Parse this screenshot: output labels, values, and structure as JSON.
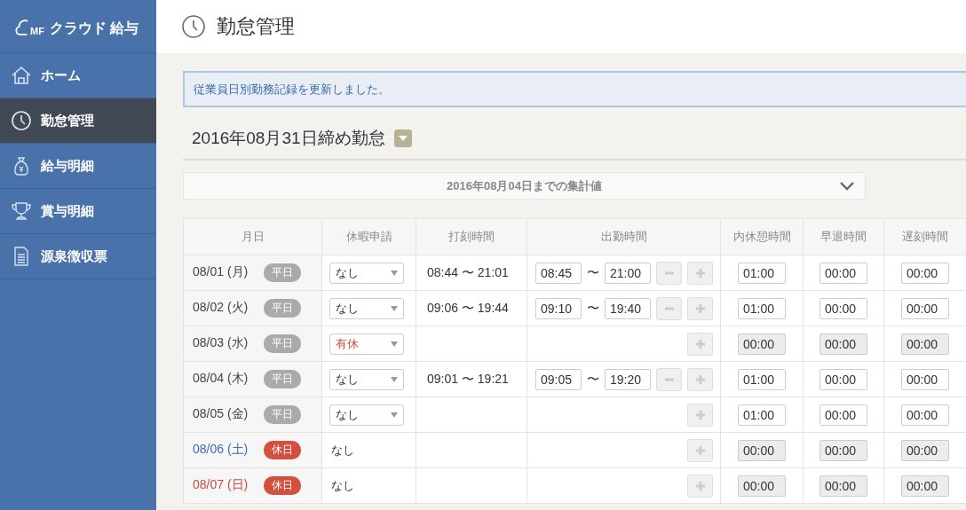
{
  "sidebar": {
    "logo": {
      "mark": "MF",
      "name": "クラウド 給与"
    },
    "items": [
      {
        "label": "ホーム",
        "selected": false
      },
      {
        "label": "勤怠管理",
        "selected": true
      },
      {
        "label": "給与明細",
        "selected": false
      },
      {
        "label": "賞与明細",
        "selected": false
      },
      {
        "label": "源泉徴収票",
        "selected": false
      }
    ]
  },
  "header": {
    "title": "勤怠管理"
  },
  "notice": "従業員日別勤務記録を更新しました。",
  "period": {
    "title": "2016年08月31日締め勤怠"
  },
  "summary": {
    "label": "2016年08月04日までの集計値",
    "expanded": false
  },
  "table": {
    "columns": [
      "月日",
      "休暇申請",
      "打刻時間",
      "出勤時間",
      "内休憩時間",
      "早退時間",
      "遅刻時間"
    ],
    "rows": [
      {
        "date": {
          "text": "08/01 (月)",
          "color": "#444444"
        },
        "badge": {
          "text": "平日",
          "color": "#aaaaaa"
        },
        "leave": {
          "value": "なし",
          "kind": "select",
          "paid": false
        },
        "punch": "08:44 〜 21:01",
        "shift": {
          "start": "08:45",
          "separator": "〜",
          "end": "21:00"
        },
        "break": "01:00",
        "early": "00:00",
        "late": "00:00",
        "disabled": false
      },
      {
        "date": {
          "text": "08/02 (火)",
          "color": "#444444"
        },
        "badge": {
          "text": "平日",
          "color": "#aaaaaa"
        },
        "leave": {
          "value": "なし",
          "kind": "select",
          "paid": false
        },
        "punch": "09:06 〜 19:44",
        "shift": {
          "start": "09:10",
          "separator": "〜",
          "end": "19:40"
        },
        "break": "01:00",
        "early": "00:00",
        "late": "00:00",
        "disabled": false
      },
      {
        "date": {
          "text": "08/03 (水)",
          "color": "#444444"
        },
        "badge": {
          "text": "平日",
          "color": "#aaaaaa"
        },
        "leave": {
          "value": "有休",
          "kind": "select",
          "paid": true
        },
        "break": "00:00",
        "early": "00:00",
        "late": "00:00",
        "disabled": true
      },
      {
        "date": {
          "text": "08/04 (木)",
          "color": "#444444"
        },
        "badge": {
          "text": "平日",
          "color": "#aaaaaa"
        },
        "leave": {
          "value": "なし",
          "kind": "select",
          "paid": false
        },
        "punch": "09:01 〜 19:21",
        "shift": {
          "start": "09:05",
          "separator": "〜",
          "end": "19:20"
        },
        "break": "01:00",
        "early": "00:00",
        "late": "00:00",
        "disabled": false
      },
      {
        "date": {
          "text": "08/05 (金)",
          "color": "#444444"
        },
        "badge": {
          "text": "平日",
          "color": "#aaaaaa"
        },
        "leave": {
          "value": "なし",
          "kind": "select",
          "paid": false
        },
        "break": "01:00",
        "early": "00:00",
        "late": "00:00",
        "disabled": false
      },
      {
        "date": {
          "text": "08/06 (土)",
          "color": "#3b6cb3"
        },
        "badge": {
          "text": "休日",
          "color": "#d2503e"
        },
        "leave": {
          "value": "なし",
          "kind": "text",
          "paid": false
        },
        "break": "00:00",
        "early": "00:00",
        "late": "00:00",
        "disabled": true
      },
      {
        "date": {
          "text": "08/07 (日)",
          "color": "#d0493a"
        },
        "badge": {
          "text": "休日",
          "color": "#d2503e"
        },
        "leave": {
          "value": "なし",
          "kind": "text",
          "paid": false
        },
        "break": "00:00",
        "early": "00:00",
        "late": "00:00",
        "disabled": true
      }
    ]
  }
}
